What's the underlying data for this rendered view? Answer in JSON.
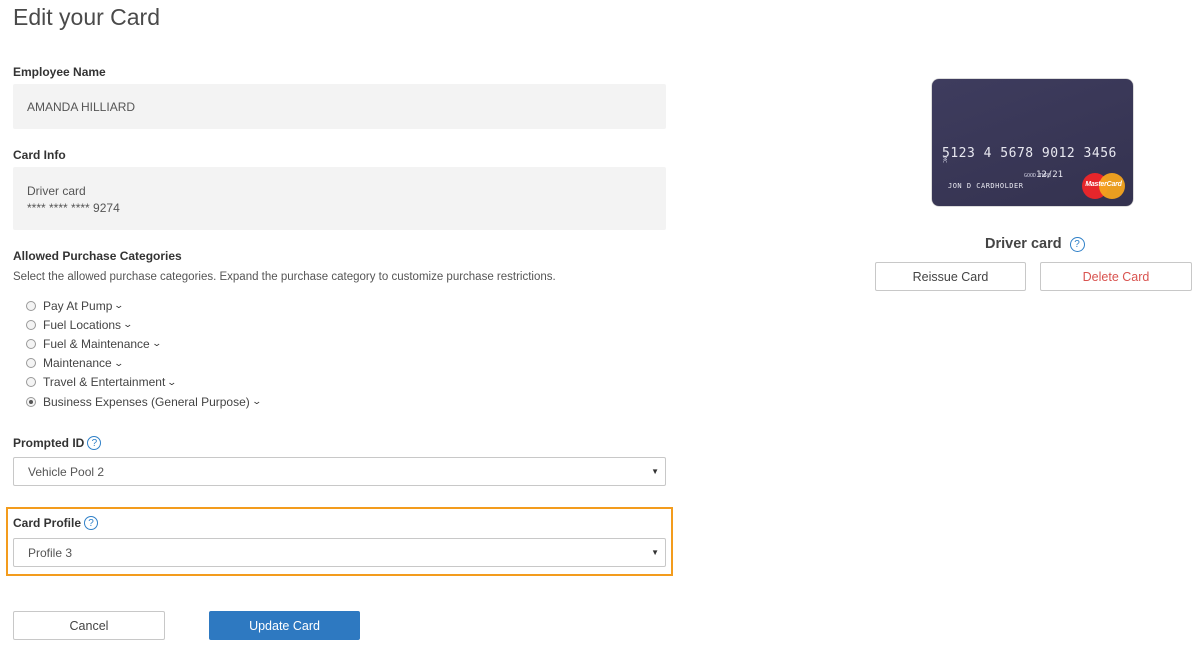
{
  "page": {
    "title": "Edit your Card"
  },
  "employee": {
    "label": "Employee Name",
    "value": "AMANDA HILLIARD"
  },
  "card_info": {
    "label": "Card Info",
    "type": "Driver card",
    "number_masked": "**** **** **** 9274"
  },
  "categories": {
    "label": "Allowed Purchase Categories",
    "helper": "Select the allowed purchase categories. Expand the purchase category to customize purchase restrictions.",
    "items": [
      {
        "label": "Pay At Pump",
        "selected": false
      },
      {
        "label": "Fuel Locations",
        "selected": false
      },
      {
        "label": "Fuel & Maintenance",
        "selected": false
      },
      {
        "label": "Maintenance",
        "selected": false
      },
      {
        "label": "Travel & Entertainment",
        "selected": false
      },
      {
        "label": "Business Expenses (General Purpose)",
        "selected": true
      }
    ]
  },
  "prompted_id": {
    "label": "Prompted ID",
    "value": "Vehicle Pool 2"
  },
  "card_profile": {
    "label": "Card Profile",
    "value": "Profile 3",
    "highlight_color": "#f39c1d"
  },
  "buttons": {
    "cancel": "Cancel",
    "update": "Update Card",
    "reissue": "Reissue Card",
    "delete": "Delete Card"
  },
  "card_preview": {
    "number": "5123 4 5678 9012 3456",
    "mc_prefix": "MC",
    "exp_label": "GOOD THRU",
    "exp": "12/21",
    "holder": "JON D CARDHOLDER",
    "brand": "MasterCard",
    "caption": "Driver card"
  },
  "icons": {
    "help": "?",
    "chevron": "⌄",
    "caret": "▼"
  },
  "colors": {
    "primary": "#2e79c1",
    "danger": "#d9534f",
    "card_bg": "#3e3c5e"
  }
}
